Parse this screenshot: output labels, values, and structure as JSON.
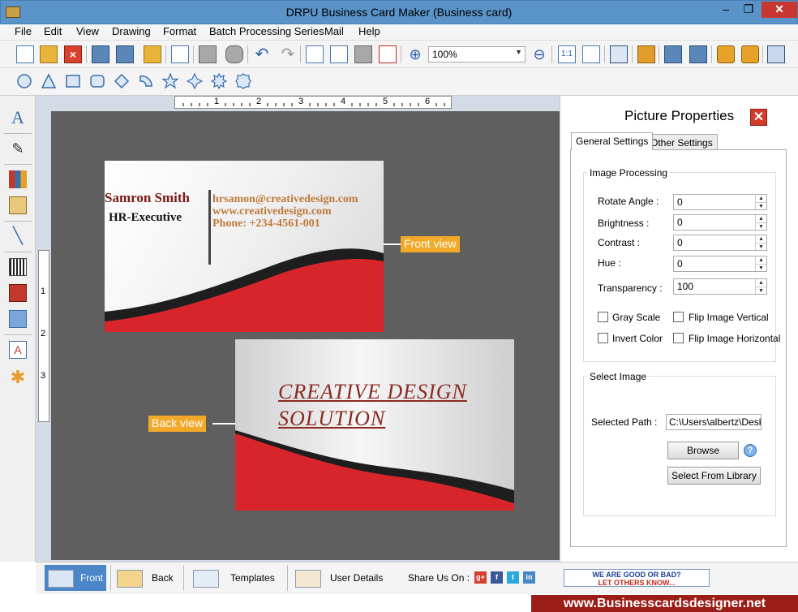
{
  "window": {
    "title": "DRPU Business Card Maker (Business card)",
    "minimize": "–",
    "maximize": "❐",
    "close": "✕"
  },
  "menu": [
    "File",
    "Edit",
    "View",
    "Drawing",
    "Format",
    "Batch Processing Series",
    "Mail",
    "Help"
  ],
  "toolbar": {
    "zoom_value": "100%"
  },
  "card_front": {
    "name": "Samron Smith",
    "job": "HR-Executive",
    "email": "hrsamon@creativedesign.com",
    "website": "www.creativedesign.com",
    "phone": "Phone: +234-4561-001",
    "tag": "Front view"
  },
  "card_back": {
    "line1": "CREATIVE DESIGN",
    "line2": "SOLUTION",
    "tag": "Back view"
  },
  "ruler_h": [
    "1",
    "2",
    "3",
    "4",
    "5",
    "6"
  ],
  "ruler_v": [
    "1",
    "2",
    "3"
  ],
  "props": {
    "title": "Picture Properties",
    "close": "✕",
    "tabs": [
      "General Settings",
      "Other Settings"
    ],
    "image_processing": {
      "title": "Image Processing",
      "fields": [
        {
          "label": "Rotate Angle :",
          "value": "0"
        },
        {
          "label": "Brightness :",
          "value": "0"
        },
        {
          "label": "Contrast :",
          "value": "0"
        },
        {
          "label": "Hue :",
          "value": "0"
        },
        {
          "label": "Transparency :",
          "value": "100"
        }
      ],
      "checks": [
        "Gray Scale",
        "Flip Image Vertical",
        "Invert Color",
        "Flip Image Horizontal"
      ]
    },
    "select_image": {
      "title": "Select Image",
      "path_label": "Selected Path :",
      "path_value": "C:\\Users\\albertz\\Deskt",
      "browse": "Browse",
      "help": "?",
      "library": "Select From Library"
    }
  },
  "bottom": {
    "front": "Front",
    "back": "Back",
    "templates": "Templates",
    "user_details": "User Details",
    "share": "Share Us On :",
    "social": [
      "g+",
      "f",
      "t",
      "in"
    ],
    "feedback_line1": "WE ARE GOOD OR BAD?",
    "feedback_line2": "LET OTHERS KNOW..."
  },
  "footer": {
    "url": "www.Businesscardsdesigner.net"
  }
}
